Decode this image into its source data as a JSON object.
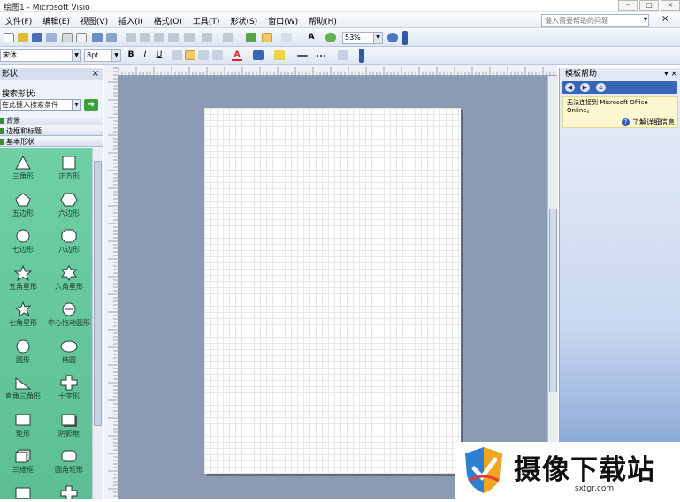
{
  "window": {
    "title": "绘图1 - Microsoft Visio",
    "controls": [
      "–",
      "□",
      "×"
    ]
  },
  "menubar": {
    "items": [
      "文件(F)",
      "编辑(E)",
      "视图(V)",
      "插入(I)",
      "格式(O)",
      "工具(T)",
      "形状(S)",
      "窗口(W)",
      "帮助(H)"
    ],
    "help_placeholder": "键入需要帮助的问题"
  },
  "toolbar": {
    "zoom_value": "53%",
    "font_value": "宋体",
    "size_value": "8pt",
    "bold_label": "B",
    "italic_label": "I",
    "underline_label": "U",
    "font_color_label": "A",
    "text_tool_label": "A"
  },
  "shapes_panel": {
    "title": "形状",
    "search_label": "搜索形状:",
    "search_value": "在此键入搜索条件",
    "stencils": [
      "背景",
      "边框和标题",
      "基本形状"
    ],
    "shapes": [
      {
        "label": "三角形",
        "icon": "triangle-icon"
      },
      {
        "label": "正方形",
        "icon": "square-icon"
      },
      {
        "label": "五边形",
        "icon": "pentagon-icon"
      },
      {
        "label": "六边形",
        "icon": "hexagon-icon"
      },
      {
        "label": "七边形",
        "icon": "heptagon-icon"
      },
      {
        "label": "八边形",
        "icon": "octagon-icon"
      },
      {
        "label": "五角星形",
        "icon": "five-point-star-icon"
      },
      {
        "label": "六角星形",
        "icon": "six-point-star-icon"
      },
      {
        "label": "七角星形",
        "icon": "seven-point-star-icon"
      },
      {
        "label": "中心拖动圆形",
        "icon": "center-drag-circle-icon"
      },
      {
        "label": "圆形",
        "icon": "circle-icon"
      },
      {
        "label": "椭圆",
        "icon": "ellipse-icon"
      },
      {
        "label": "直角三角形",
        "icon": "right-triangle-icon"
      },
      {
        "label": "十字形",
        "icon": "cross-icon"
      },
      {
        "label": "矩形",
        "icon": "rectangle-icon"
      },
      {
        "label": "阴影框",
        "icon": "shadow-box-icon"
      },
      {
        "label": "三维框",
        "icon": "3d-box-icon"
      },
      {
        "label": "圆角矩形",
        "icon": "rounded-rectangle-icon"
      }
    ]
  },
  "taskpane": {
    "title": "模板帮助",
    "message": "无法连接到 Microsoft Office Online。",
    "more_link": "了解详细信息"
  },
  "watermark": {
    "brand": "摄像下载站",
    "url": "sxtgr.com"
  }
}
